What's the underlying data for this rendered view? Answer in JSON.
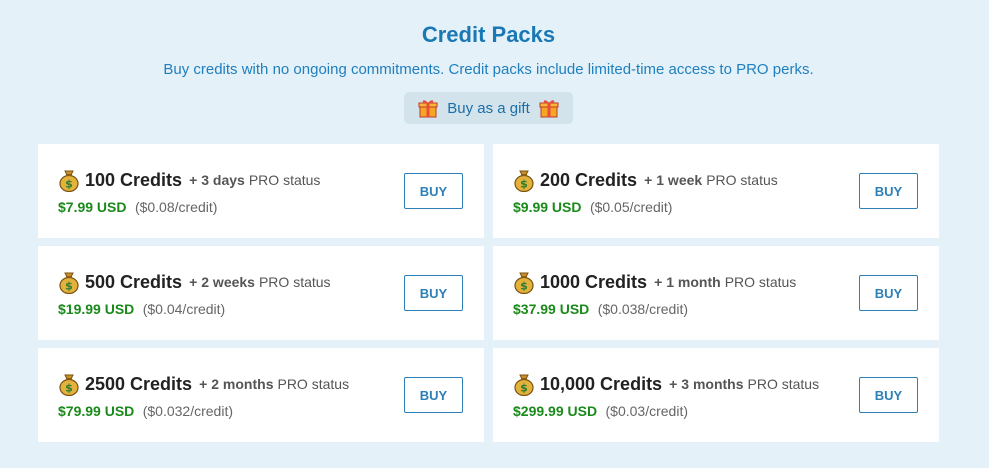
{
  "header": {
    "title": "Credit Packs",
    "subtitle": "Buy credits with no ongoing commitments. Credit packs include limited-time access to PRO perks.",
    "gift_label": "Buy as a gift"
  },
  "packs": [
    {
      "credits": "100 Credits",
      "plus": "+",
      "duration": "3 days",
      "pro": "PRO status",
      "price": "$7.99 USD",
      "per_credit": "($0.08/credit)",
      "buy_label": "BUY"
    },
    {
      "credits": "200 Credits",
      "plus": "+",
      "duration": "1 week",
      "pro": "PRO status",
      "price": "$9.99 USD",
      "per_credit": "($0.05/credit)",
      "buy_label": "BUY"
    },
    {
      "credits": "500 Credits",
      "plus": "+",
      "duration": "2 weeks",
      "pro": "PRO status",
      "price": "$19.99 USD",
      "per_credit": "($0.04/credit)",
      "buy_label": "BUY"
    },
    {
      "credits": "1000 Credits",
      "plus": "+",
      "duration": "1 month",
      "pro": "PRO status",
      "price": "$37.99 USD",
      "per_credit": "($0.038/credit)",
      "buy_label": "BUY"
    },
    {
      "credits": "2500 Credits",
      "plus": "+",
      "duration": "2 months",
      "pro": "PRO status",
      "price": "$79.99 USD",
      "per_credit": "($0.032/credit)",
      "buy_label": "BUY"
    },
    {
      "credits": "10,000 Credits",
      "plus": "+",
      "duration": "3 months",
      "pro": "PRO status",
      "price": "$299.99 USD",
      "per_credit": "($0.03/credit)",
      "buy_label": "BUY"
    }
  ],
  "icons": {
    "gift": "gift-icon",
    "money_bag": "money-bag-icon"
  },
  "colors": {
    "background": "#e4f1f8",
    "title": "#1a78b4",
    "price": "#1a8a1a",
    "button": "#2d7fb8"
  }
}
